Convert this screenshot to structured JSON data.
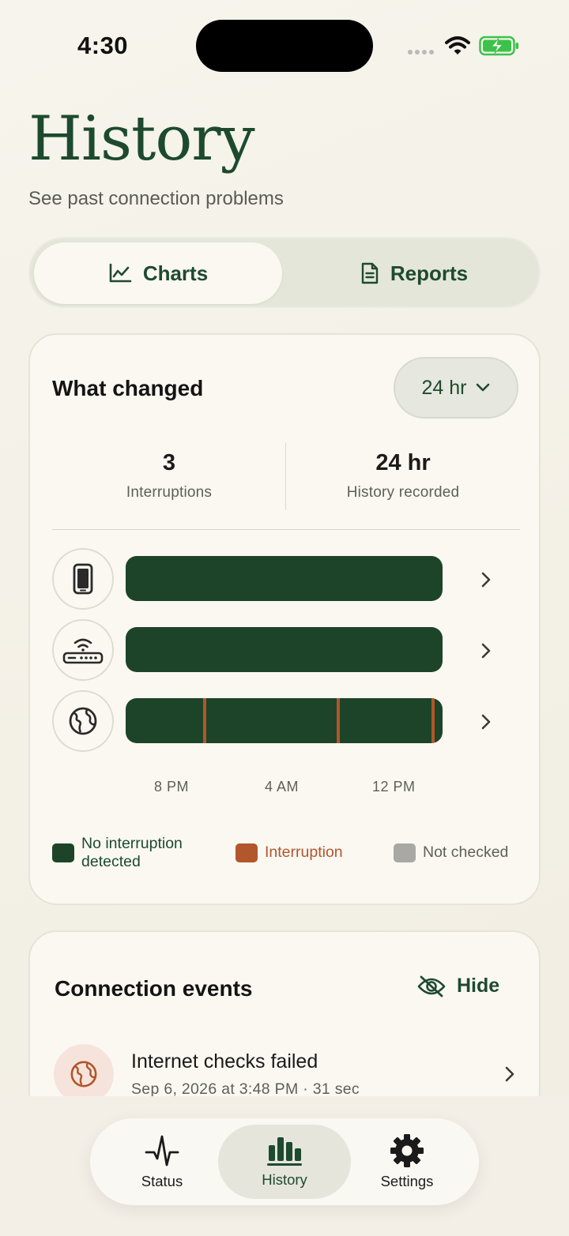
{
  "status_bar": {
    "time": "4:30"
  },
  "header": {
    "title": "History",
    "subtitle": "See past connection problems"
  },
  "tabs": [
    {
      "label": "Charts",
      "icon": "line-chart-icon",
      "active": true
    },
    {
      "label": "Reports",
      "icon": "document-icon",
      "active": false
    }
  ],
  "what_changed": {
    "heading": "What changed",
    "range_label": "24 hr",
    "stats": [
      {
        "value": "3",
        "label": "Interruptions"
      },
      {
        "value": "24 hr",
        "label": "History recorded"
      }
    ],
    "rows": [
      {
        "name": "phone",
        "icon": "phone-icon",
        "interruption_positions": []
      },
      {
        "name": "router",
        "icon": "router-icon",
        "interruption_positions": []
      },
      {
        "name": "internet",
        "icon": "globe-icon",
        "interruption_positions": [
          0.25,
          0.67,
          0.97
        ]
      }
    ],
    "time_labels": [
      "8 PM",
      "4 AM",
      "12 PM"
    ],
    "legend": [
      {
        "label": "No interruption detected",
        "color": "#1d4429",
        "text_color": "#1e4a30"
      },
      {
        "label": "Interruption",
        "color": "#b2562c",
        "text_color": "#b2562c"
      },
      {
        "label": "Not checked",
        "color": "#a8a8a4",
        "text_color": "#5f5f58"
      }
    ]
  },
  "connection_events": {
    "heading": "Connection events",
    "hide_label": "Hide",
    "events": [
      {
        "title": "Internet checks failed",
        "subtitle": "Sep 6, 2026 at 3:48 PM · 31 sec",
        "icon": "globe-icon"
      }
    ]
  },
  "nav": [
    {
      "label": "Status",
      "icon": "pulse-icon",
      "active": false
    },
    {
      "label": "History",
      "icon": "bar-chart-icon",
      "active": true
    },
    {
      "label": "Settings",
      "icon": "gear-icon",
      "active": false
    }
  ]
}
